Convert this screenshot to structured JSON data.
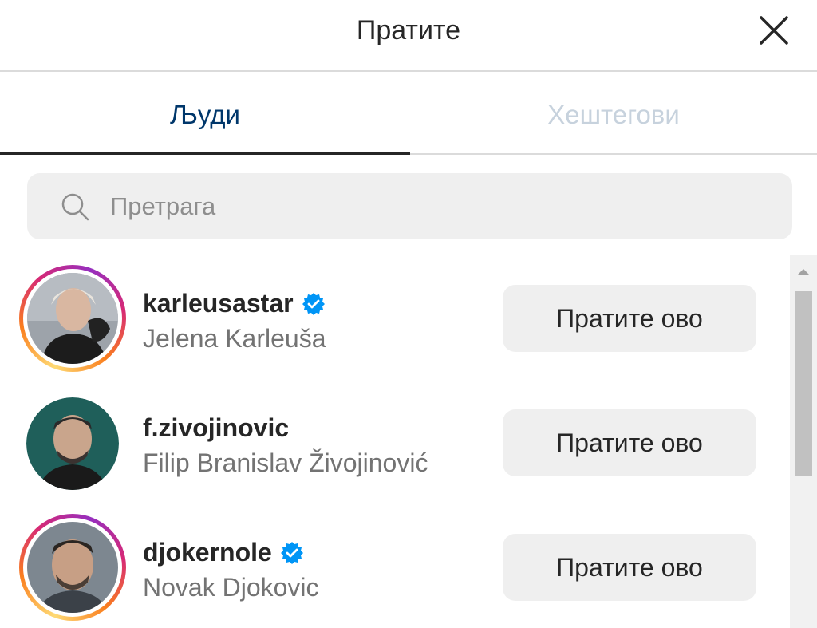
{
  "header": {
    "title": "Пратите",
    "close_icon": "close-icon"
  },
  "tabs": [
    {
      "label": "Људи",
      "active": true
    },
    {
      "label": "Хештегови",
      "active": false
    }
  ],
  "search": {
    "placeholder": "Претрага",
    "value": "",
    "icon": "search-icon"
  },
  "accounts": [
    {
      "username": "karleusastar",
      "full_name": "Jelena Karleuša",
      "verified": true,
      "story_ring": true,
      "button_label": "Пратите ово"
    },
    {
      "username": "f.zivojinovic",
      "full_name": "Filip Branislav Živojinović",
      "verified": false,
      "story_ring": false,
      "button_label": "Пратите ово"
    },
    {
      "username": "djokernole",
      "full_name": "Novak Djokovic",
      "verified": true,
      "story_ring": true,
      "button_label": "Пратите ово"
    }
  ],
  "colors": {
    "active_tab": "#00376b",
    "inactive_tab": "#c7d2dd",
    "verified_badge": "#0095f6",
    "button_bg": "#efefef",
    "secondary_text": "#737373"
  }
}
